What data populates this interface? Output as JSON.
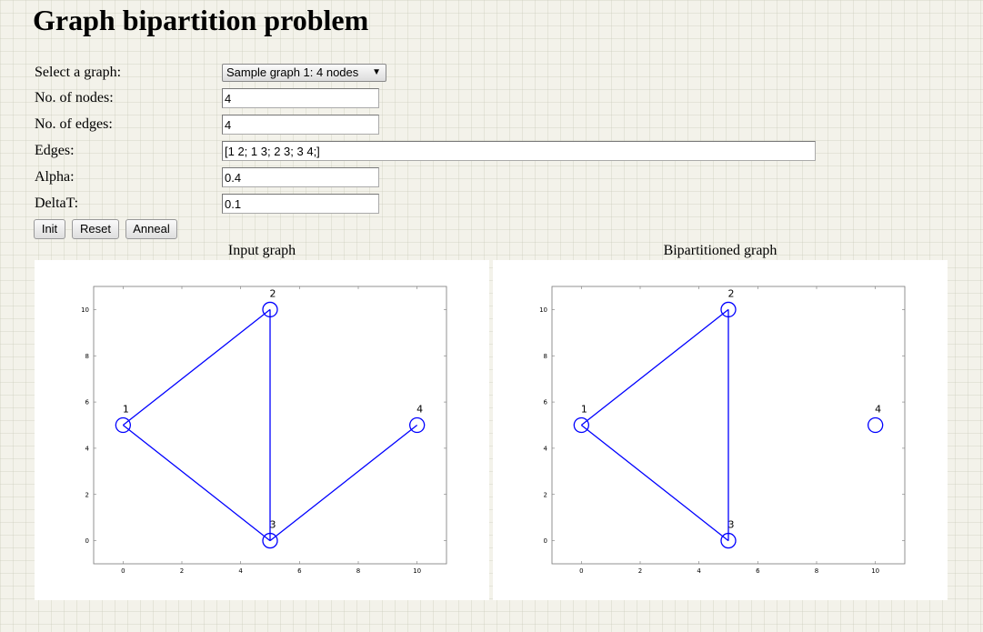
{
  "page": {
    "title": "Graph bipartition problem"
  },
  "form": {
    "select_graph": {
      "label": "Select a graph:",
      "value": "Sample graph 1: 4 nodes"
    },
    "nodes": {
      "label": "No. of nodes:",
      "value": "4"
    },
    "edges_count": {
      "label": "No. of edges:",
      "value": "4"
    },
    "edges": {
      "label": "Edges:",
      "value": "[1 2; 1 3; 2 3; 3 4;]"
    },
    "alpha": {
      "label": "Alpha:",
      "value": "0.4"
    },
    "deltat": {
      "label": "DeltaT:",
      "value": "0.1"
    }
  },
  "buttons": {
    "init": "Init",
    "reset": "Reset",
    "anneal": "Anneal"
  },
  "colors": {
    "graph": "#0000ff"
  },
  "chart_data": [
    {
      "type": "scatter",
      "title": "Input graph",
      "xlim": [
        -1,
        11
      ],
      "ylim": [
        -1,
        11
      ],
      "xticks": [
        0,
        2,
        4,
        6,
        8,
        10
      ],
      "yticks": [
        0,
        2,
        4,
        6,
        8,
        10
      ],
      "nodes": [
        {
          "label": "1",
          "x": 0,
          "y": 5
        },
        {
          "label": "2",
          "x": 5,
          "y": 10
        },
        {
          "label": "3",
          "x": 5,
          "y": 0
        },
        {
          "label": "4",
          "x": 10,
          "y": 5
        }
      ],
      "edges": [
        [
          1,
          2
        ],
        [
          1,
          3
        ],
        [
          2,
          3
        ],
        [
          3,
          4
        ]
      ]
    },
    {
      "type": "scatter",
      "title": "Bipartitioned graph",
      "xlim": [
        -1,
        11
      ],
      "ylim": [
        -1,
        11
      ],
      "xticks": [
        0,
        2,
        4,
        6,
        8,
        10
      ],
      "yticks": [
        0,
        2,
        4,
        6,
        8,
        10
      ],
      "nodes": [
        {
          "label": "1",
          "x": 0,
          "y": 5
        },
        {
          "label": "2",
          "x": 5,
          "y": 10
        },
        {
          "label": "3",
          "x": 5,
          "y": 0
        },
        {
          "label": "4",
          "x": 10,
          "y": 5
        }
      ],
      "edges": [
        [
          1,
          2
        ],
        [
          1,
          3
        ],
        [
          2,
          3
        ]
      ]
    }
  ]
}
